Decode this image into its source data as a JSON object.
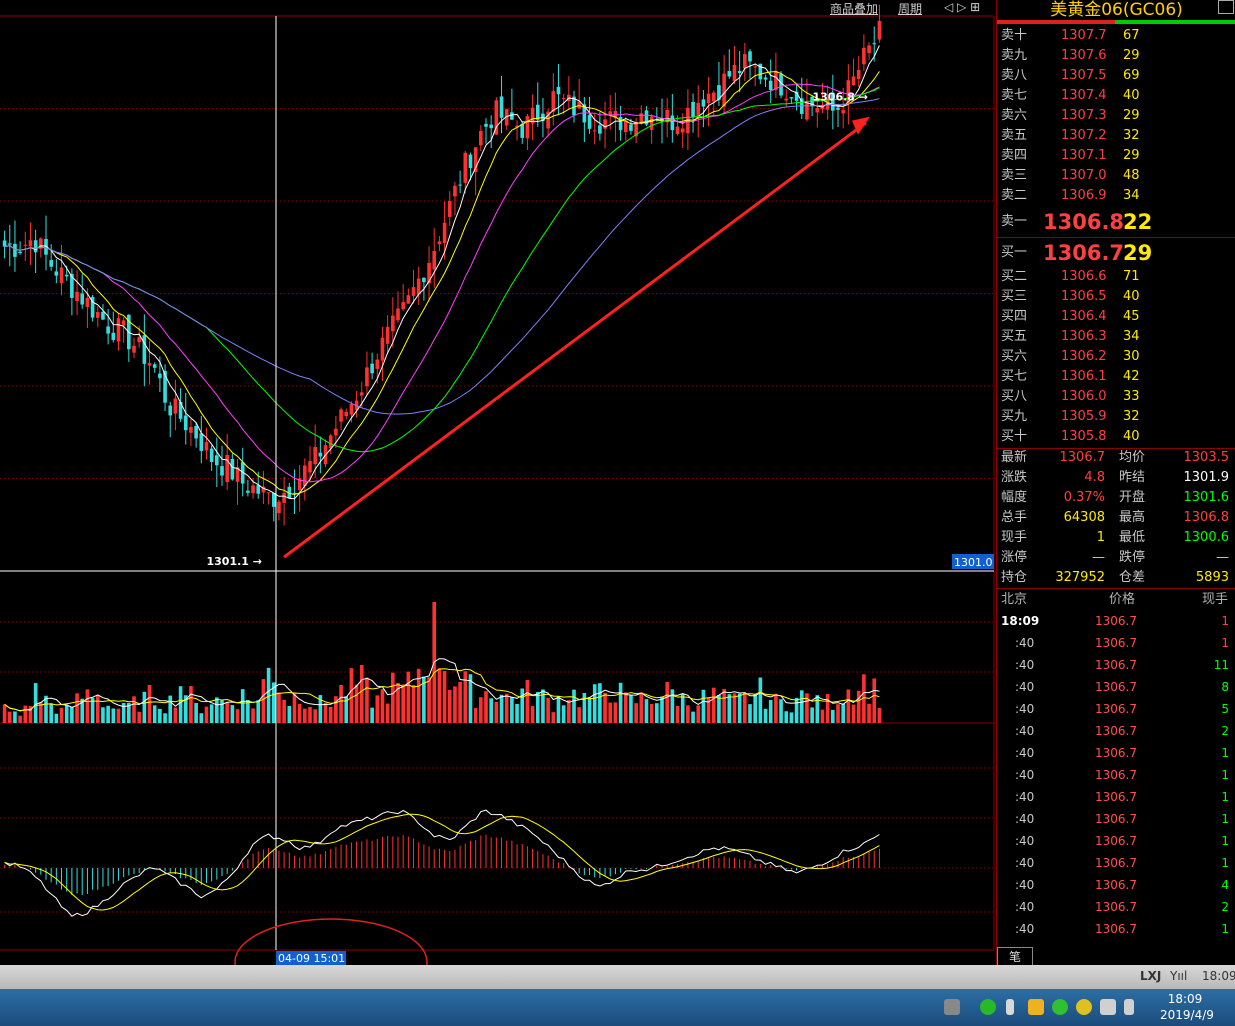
{
  "toolbar": {
    "overlay_label": "商品叠加",
    "period_label": "周期",
    "nav_label": "◁ ▷ ⊞"
  },
  "chart_markers": {
    "high_label": "1306.8",
    "low_label": "1301.1",
    "price_tag": "1301.0",
    "cursor_time": "04-09 15:01"
  },
  "colors": {
    "up": "#ff3030",
    "down": "#30e0e0",
    "ma1": "#ffffff",
    "ma2": "#ffff00",
    "ma3": "#ff40ff",
    "ma4": "#00ff00",
    "ma5": "#8080ff",
    "grid": "#8c0000",
    "arrow": "#ff2020"
  },
  "chart_data": {
    "type": "candlestick",
    "price_close_series": [
      1305.0,
      1305.0,
      1305.1,
      1304.8,
      1304.6,
      1304.4,
      1304.2,
      1304.0,
      1303.9,
      1303.7,
      1303.5,
      1303.0,
      1302.8,
      1302.6,
      1302.3,
      1302.2,
      1302.0,
      1301.9,
      1301.8,
      1301.9,
      1302.1,
      1302.3,
      1302.6,
      1302.9,
      1303.2,
      1303.6,
      1303.9,
      1304.2,
      1304.6,
      1305.0,
      1305.5,
      1306.0,
      1306.4,
      1306.7,
      1306.6,
      1306.5,
      1306.7,
      1306.9,
      1306.8,
      1306.7,
      1306.6,
      1306.6,
      1306.6,
      1306.7,
      1306.7,
      1306.6,
      1306.7,
      1306.9,
      1307.0,
      1307.2,
      1307.3,
      1307.2,
      1307.1,
      1307.0,
      1306.8,
      1306.8,
      1306.7,
      1307.0,
      1307.4,
      1307.7
    ],
    "ylim": [
      1301.0,
      1307.8
    ],
    "high": 1306.8,
    "low": 1301.1,
    "volume_series": [
      20,
      10,
      45,
      30,
      15,
      35,
      50,
      25,
      20,
      30,
      40,
      25,
      60,
      20,
      35,
      30,
      40,
      25,
      90,
      30,
      45,
      25,
      35,
      50,
      60,
      30,
      55,
      45,
      80,
      130,
      70,
      55,
      40,
      50,
      35,
      45,
      40,
      30,
      45,
      35,
      40,
      55,
      30,
      35,
      40,
      45,
      30,
      35,
      40,
      30,
      35,
      45,
      30,
      30,
      40,
      25,
      35,
      50,
      60,
      40
    ],
    "macd_series": [
      0.05,
      0.02,
      -0.1,
      -0.3,
      -0.5,
      -0.45,
      -0.35,
      -0.2,
      -0.1,
      0.0,
      -0.1,
      -0.2,
      -0.3,
      -0.2,
      0.0,
      0.25,
      0.35,
      0.3,
      0.2,
      0.25,
      0.4,
      0.45,
      0.5,
      0.55,
      0.6,
      0.5,
      0.35,
      0.3,
      0.45,
      0.6,
      0.55,
      0.45,
      0.35,
      0.2,
      0.05,
      -0.1,
      -0.2,
      -0.1,
      0.0,
      0.0,
      0.05,
      0.1,
      0.15,
      0.2,
      0.18,
      0.12,
      0.05,
      0.0,
      -0.05,
      0.02,
      0.1,
      0.2,
      0.25,
      0.35
    ]
  },
  "symbol": {
    "title": "美黄金06(GC06)"
  },
  "order_book": {
    "asks": [
      {
        "label": "卖十",
        "price": "1307.7",
        "vol": "67"
      },
      {
        "label": "卖九",
        "price": "1307.6",
        "vol": "29"
      },
      {
        "label": "卖八",
        "price": "1307.5",
        "vol": "69"
      },
      {
        "label": "卖七",
        "price": "1307.4",
        "vol": "40"
      },
      {
        "label": "卖六",
        "price": "1307.3",
        "vol": "29"
      },
      {
        "label": "卖五",
        "price": "1307.2",
        "vol": "32"
      },
      {
        "label": "卖四",
        "price": "1307.1",
        "vol": "29"
      },
      {
        "label": "卖三",
        "price": "1307.0",
        "vol": "48"
      },
      {
        "label": "卖二",
        "price": "1306.9",
        "vol": "34"
      },
      {
        "label": "卖一",
        "price": "1306.8",
        "vol": "22"
      }
    ],
    "bids": [
      {
        "label": "买一",
        "price": "1306.7",
        "vol": "29"
      },
      {
        "label": "买二",
        "price": "1306.6",
        "vol": "71"
      },
      {
        "label": "买三",
        "price": "1306.5",
        "vol": "40"
      },
      {
        "label": "买四",
        "price": "1306.4",
        "vol": "45"
      },
      {
        "label": "买五",
        "price": "1306.3",
        "vol": "34"
      },
      {
        "label": "买六",
        "price": "1306.2",
        "vol": "30"
      },
      {
        "label": "买七",
        "price": "1306.1",
        "vol": "42"
      },
      {
        "label": "买八",
        "price": "1306.0",
        "vol": "33"
      },
      {
        "label": "买九",
        "price": "1305.9",
        "vol": "32"
      },
      {
        "label": "买十",
        "price": "1305.8",
        "vol": "40"
      }
    ]
  },
  "quote": [
    {
      "l1": "最新",
      "v1": "1306.7",
      "c1": "#ff4040",
      "l2": "均价",
      "v2": "1303.5",
      "c2": "#ff4040"
    },
    {
      "l1": "涨跌",
      "v1": "4.8",
      "c1": "#ff4040",
      "l2": "昨结",
      "v2": "1301.9",
      "c2": "#ffffff"
    },
    {
      "l1": "幅度",
      "v1": "0.37%",
      "c1": "#ff4040",
      "l2": "开盘",
      "v2": "1301.6",
      "c2": "#00ff00"
    },
    {
      "l1": "总手",
      "v1": "64308",
      "c1": "#ffea00",
      "l2": "最高",
      "v2": "1306.8",
      "c2": "#ff4040"
    },
    {
      "l1": "现手",
      "v1": "1",
      "c1": "#ffea00",
      "l2": "最低",
      "v2": "1300.6",
      "c2": "#00ff00"
    },
    {
      "l1": "涨停",
      "v1": "—",
      "c1": "#c8c8c8",
      "l2": "跌停",
      "v2": "—",
      "c2": "#c8c8c8"
    },
    {
      "l1": "持仓",
      "v1": "327952",
      "c1": "#ffea00",
      "l2": "仓差",
      "v2": "5893",
      "c2": "#ffea00"
    }
  ],
  "ticks_header": {
    "place": "北京",
    "price": "价格",
    "qty": "现手"
  },
  "ticks": [
    {
      "time": "18:09",
      "price": "1306.7",
      "qty": "1",
      "qc": "#ff4040"
    },
    {
      "time": ":40",
      "price": "1306.7",
      "qty": "1",
      "qc": "#ff4040"
    },
    {
      "time": ":40",
      "price": "1306.7",
      "qty": "11",
      "qc": "#00ff00"
    },
    {
      "time": ":40",
      "price": "1306.7",
      "qty": "8",
      "qc": "#00ff00"
    },
    {
      "time": ":40",
      "price": "1306.7",
      "qty": "5",
      "qc": "#00ff00"
    },
    {
      "time": ":40",
      "price": "1306.7",
      "qty": "2",
      "qc": "#00ff00"
    },
    {
      "time": ":40",
      "price": "1306.7",
      "qty": "1",
      "qc": "#00ff00"
    },
    {
      "time": ":40",
      "price": "1306.7",
      "qty": "1",
      "qc": "#00ff00"
    },
    {
      "time": ":40",
      "price": "1306.7",
      "qty": "1",
      "qc": "#00ff00"
    },
    {
      "time": ":40",
      "price": "1306.7",
      "qty": "1",
      "qc": "#00ff00"
    },
    {
      "time": ":40",
      "price": "1306.7",
      "qty": "1",
      "qc": "#00ff00"
    },
    {
      "time": ":40",
      "price": "1306.7",
      "qty": "1",
      "qc": "#00ff00"
    },
    {
      "time": ":40",
      "price": "1306.7",
      "qty": "4",
      "qc": "#00ff00"
    },
    {
      "time": ":40",
      "price": "1306.7",
      "qty": "2",
      "qc": "#00ff00"
    },
    {
      "time": ":40",
      "price": "1306.7",
      "qty": "1",
      "qc": "#00ff00"
    }
  ],
  "tab": {
    "label": "笔"
  },
  "status_bar": {
    "lxj": "LXJ",
    "signal": "Yııl",
    "time": "18:09"
  },
  "taskbar": {
    "time": "18:09",
    "date": "2019/4/9"
  }
}
